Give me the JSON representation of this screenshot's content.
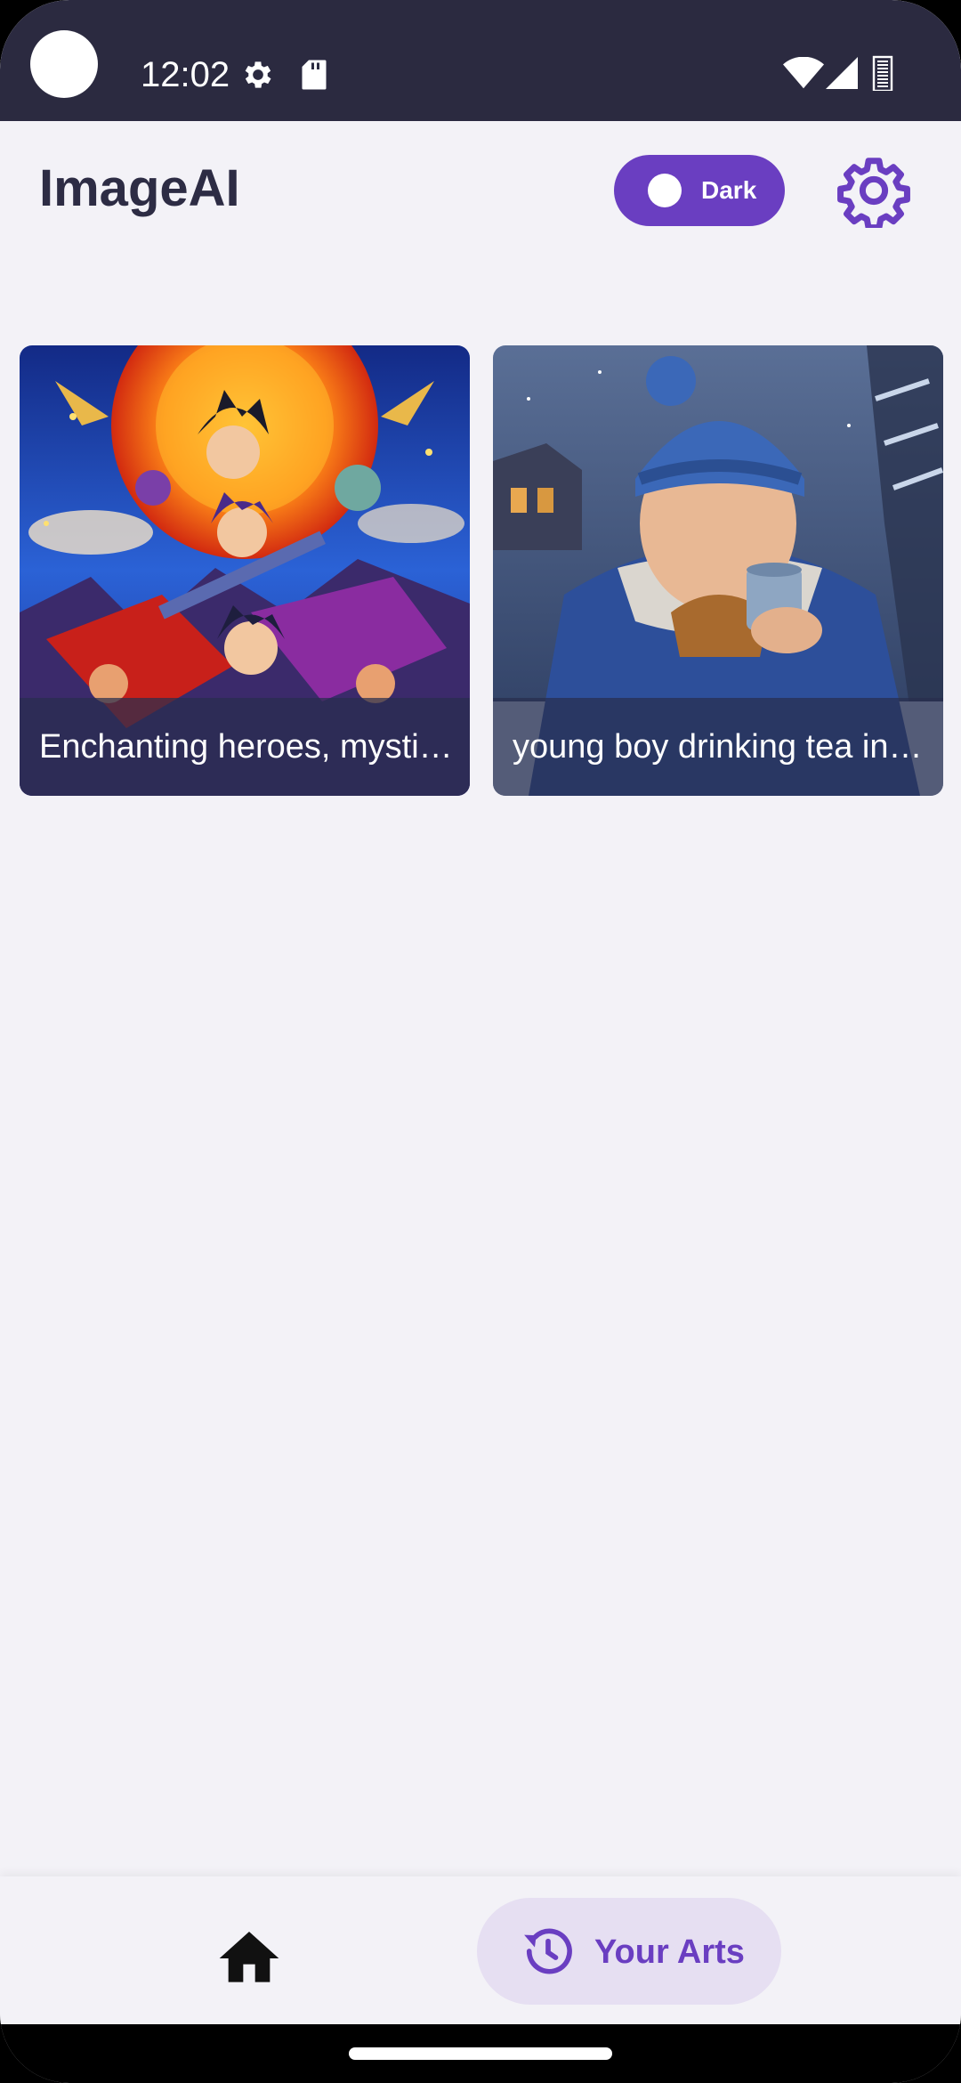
{
  "status_bar": {
    "time": "12:02",
    "icons": [
      "camera-cutout",
      "settings-gear-icon",
      "sd-card-icon",
      "wifi-icon",
      "cell-signal-icon",
      "battery-icon"
    ]
  },
  "header": {
    "app_title": "ImageAI",
    "theme_toggle_label": "Dark",
    "settings_icon": "gear-icon"
  },
  "gallery": {
    "cards": [
      {
        "caption": "Enchanting heroes, mysti…"
      },
      {
        "caption": "young boy drinking tea in…"
      }
    ]
  },
  "bottom_nav": {
    "home_icon": "home-icon",
    "arts_icon": "history-icon",
    "arts_label": "Your Arts"
  },
  "colors": {
    "accent": "#6a3ec1",
    "status_bar": "#2b2a40",
    "background": "#f3f2f7",
    "title": "#2d2c44",
    "nav_pill": "#e6dff2"
  }
}
